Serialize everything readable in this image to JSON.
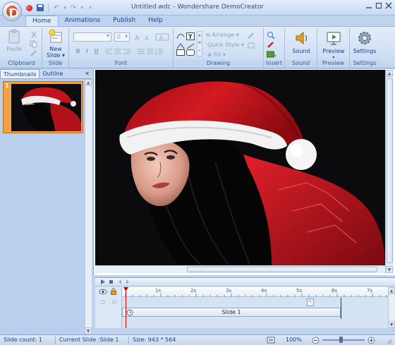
{
  "window": {
    "title": "Untitled.wdc - Wondershare DemoCreator"
  },
  "ribbon": {
    "tabs": [
      {
        "label": "Home",
        "active": true
      },
      {
        "label": "Animations",
        "active": false
      },
      {
        "label": "Publish",
        "active": false
      },
      {
        "label": "Help",
        "active": false
      }
    ],
    "clipboard": {
      "paste": "Paste",
      "group": "Clipboard"
    },
    "slide": {
      "new_slide": "New",
      "new_slide_2": "Slide",
      "group": "Slide"
    },
    "font": {
      "size_value": "0",
      "group": "Font"
    },
    "drawing": {
      "arrange": "Arrange",
      "quick_style": "Quick Style",
      "fill": "Fill",
      "group": "Drawing"
    },
    "insert": {
      "group": "Insert"
    },
    "sound": {
      "button": "Sound",
      "group": "Sound"
    },
    "preview": {
      "button": "Preview",
      "group": "Preview"
    },
    "settings": {
      "button": "Settings",
      "group": "Settings"
    }
  },
  "left_pane": {
    "tabs": [
      "Thumbnails",
      "Outline"
    ],
    "slides": [
      {
        "number": "1"
      }
    ]
  },
  "timeline": {
    "ruler": [
      "1s",
      "2s",
      "3s",
      "4s",
      "5s",
      "6s",
      "7s"
    ],
    "track_label": "Slide 1"
  },
  "status": {
    "slide_count": "Slide count: 1",
    "current_slide": "Current Slide :Slide 1",
    "size": "Size: 943 * 564",
    "zoom": "100%"
  },
  "colors": {
    "accent": "#15428b",
    "selection": "#f0a24a",
    "playhead": "#d40000"
  }
}
